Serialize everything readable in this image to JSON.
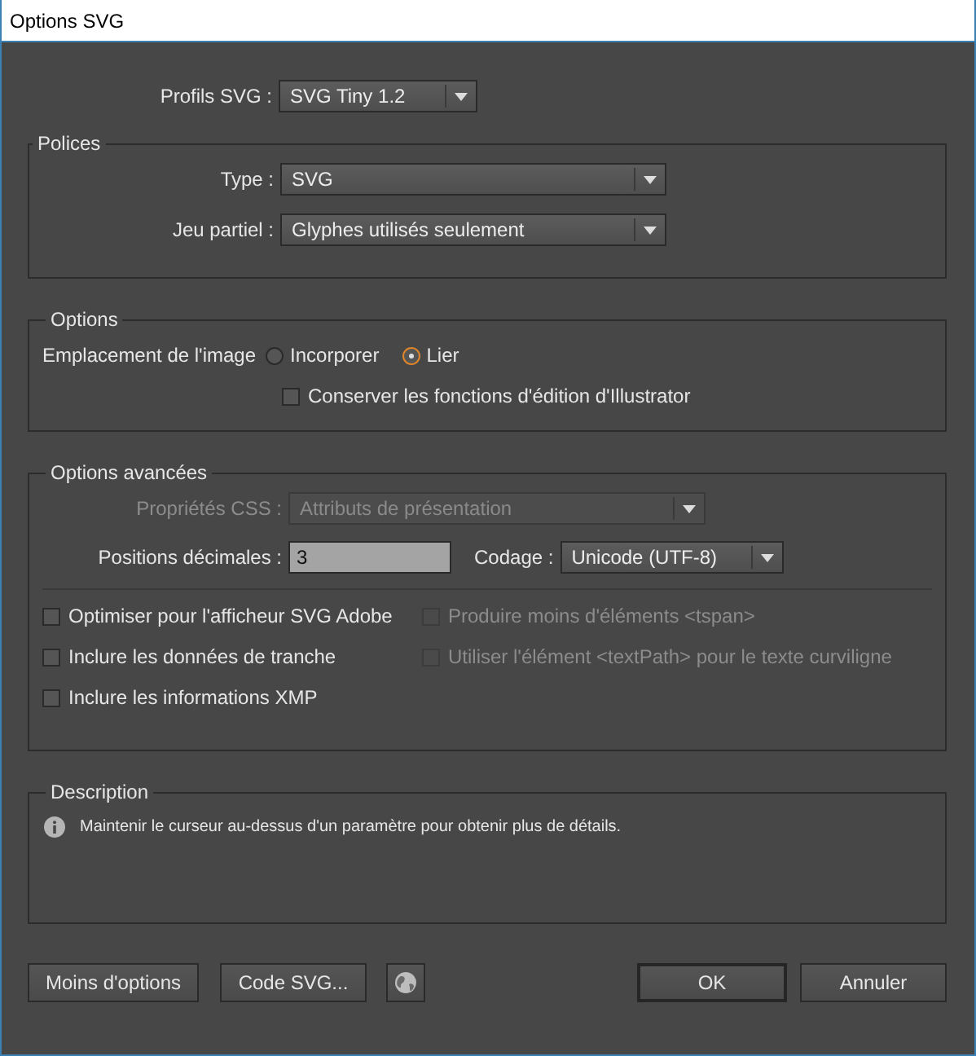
{
  "window": {
    "title": "Options SVG"
  },
  "profile": {
    "label": "Profils SVG :",
    "value": "SVG Tiny 1.2"
  },
  "fonts": {
    "title": "Polices",
    "fields": [
      {
        "label": "Type :",
        "value": "SVG"
      },
      {
        "label": "Jeu partiel :",
        "value": "Glyphes utilisés seulement"
      }
    ]
  },
  "options": {
    "title": "Options",
    "image_placement": {
      "label": "Emplacement de l'image",
      "choices": [
        {
          "label": "Incorporer",
          "selected": false
        },
        {
          "label": "Lier",
          "selected": true
        }
      ]
    },
    "preserve_editing": {
      "label": "Conserver les fonctions d'édition d'Illustrator",
      "checked": false
    }
  },
  "advanced": {
    "title": "Options avancées",
    "css": {
      "label": "Propriétés CSS :",
      "value": "Attributs de présentation",
      "disabled": true
    },
    "decimals": {
      "label": "Positions décimales :",
      "value": "3"
    },
    "encoding": {
      "label": "Codage :",
      "value": "Unicode (UTF-8)"
    },
    "checkboxes": [
      {
        "label": "Optimiser pour l'afficheur SVG Adobe",
        "checked": false,
        "disabled": false
      },
      {
        "label": "Produire moins d'éléments <tspan>",
        "checked": false,
        "disabled": true
      },
      {
        "label": "Inclure les données de tranche",
        "checked": false,
        "disabled": false
      },
      {
        "label": "Utiliser l'élément <textPath> pour le texte curviligne",
        "checked": false,
        "disabled": true
      },
      {
        "label": "Inclure les informations XMP",
        "checked": false,
        "disabled": false
      }
    ]
  },
  "description": {
    "title": "Description",
    "text": "Maintenir le curseur au-dessus d'un paramètre pour obtenir plus de détails."
  },
  "buttons": [
    {
      "kind": "text",
      "label": "Moins d'options",
      "default": false
    },
    {
      "kind": "text",
      "label": "Code SVG...",
      "default": false
    },
    {
      "kind": "globe",
      "default": false
    },
    {
      "kind": "text",
      "label": "OK",
      "default": true
    },
    {
      "kind": "text",
      "label": "Annuler",
      "default": false
    }
  ]
}
